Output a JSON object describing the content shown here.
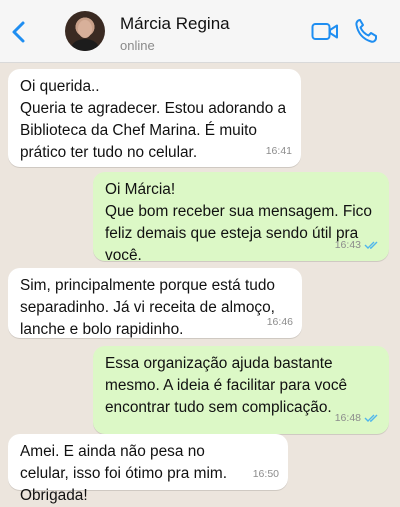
{
  "header": {
    "contact_name": "Márcia Regina",
    "status": "online",
    "icons": {
      "back": "chevron-left-icon",
      "video": "video-camera-icon",
      "call": "phone-icon"
    },
    "accent_color": "#1f8ef1"
  },
  "chat": {
    "background_color": "#ece5dd",
    "incoming_color": "#ffffff",
    "outgoing_color": "#dcf8c6",
    "read_tick_color": "#4fb6ec",
    "messages": [
      {
        "direction": "in",
        "text": "Oi querida..\nQueria te agradecer. Estou adorando a Biblioteca da Chef Marina. É muito prático ter tudo no celular.",
        "time": "16:41"
      },
      {
        "direction": "out",
        "text": "Oi Márcia!\nQue bom receber sua mensagem. Fico feliz demais que esteja sendo útil pra você.",
        "time": "16:43",
        "read": true
      },
      {
        "direction": "in",
        "text": "Sim, principalmente porque está tudo separadinho. Já vi receita de almoço, lanche e bolo rapidinho.",
        "time": "16:46"
      },
      {
        "direction": "out",
        "text": "Essa organização ajuda bastante mesmo. A ideia é facilitar para você encontrar tudo sem complicação.",
        "time": "16:48",
        "read": true
      },
      {
        "direction": "in",
        "text": "Amei. E ainda não pesa no celular, isso foi ótimo pra mim. Obrigada!",
        "time": "16:50"
      }
    ]
  }
}
